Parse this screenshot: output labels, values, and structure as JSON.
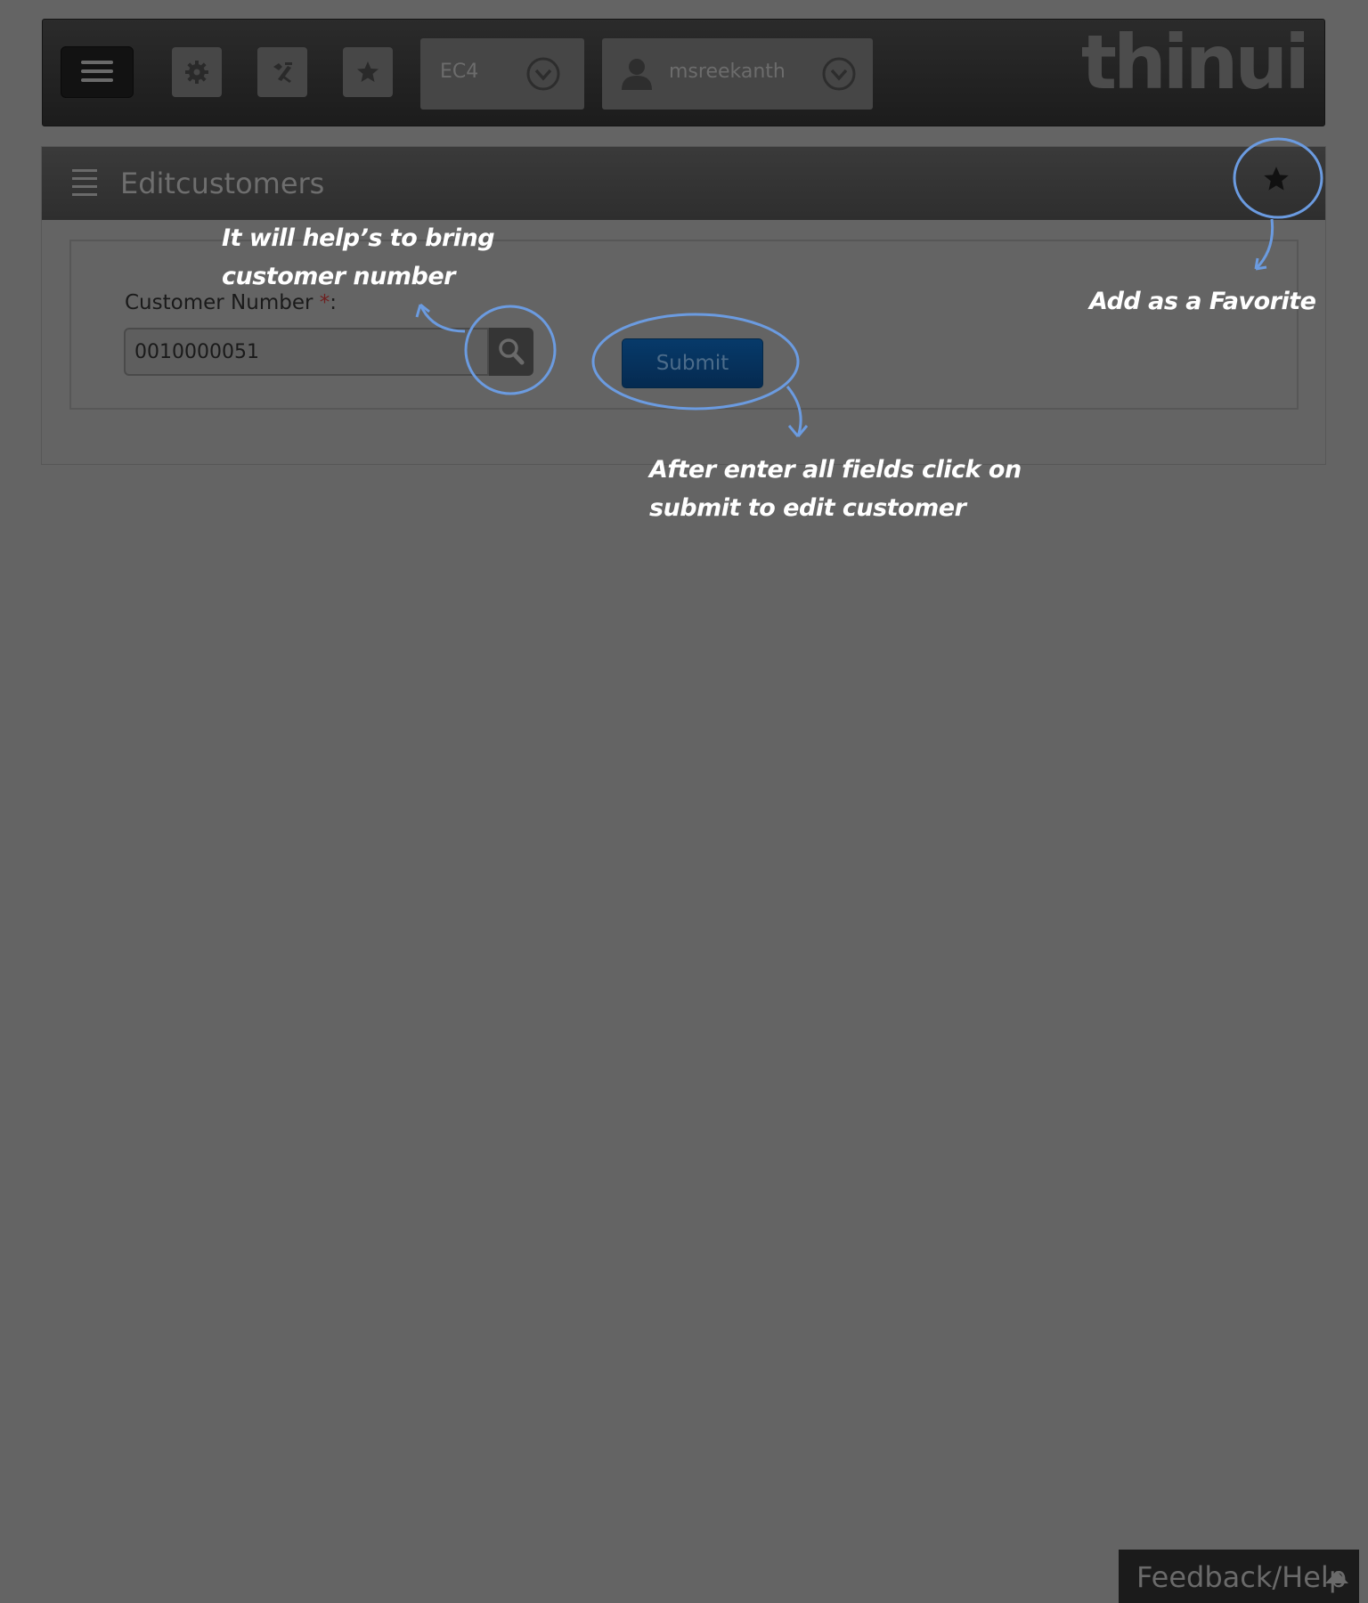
{
  "header": {
    "environment": "EC4",
    "username": "msreekanth",
    "logo": "thinui",
    "icons": [
      "menu-icon",
      "gear-icon",
      "tools-icon",
      "star-icon",
      "chevron-down-icon",
      "user-icon"
    ]
  },
  "page": {
    "title": "Editcustomers"
  },
  "form": {
    "customer_number_label": "Customer Number",
    "required_mark": "*",
    "label_colon": ":",
    "customer_number_value": "0010000051",
    "submit_label": "Submit"
  },
  "annotations": {
    "search_hint_line1": "It will help’s to bring",
    "search_hint_line2": "customer number",
    "favorite_hint": "Add as a Favorite",
    "submit_hint_line1": "After enter all fields click on",
    "submit_hint_line2": "submit to edit customer"
  },
  "footer": {
    "feedback_label": "Feedback/Help"
  },
  "colors": {
    "background": "#646464",
    "annotation_circle": "#6b9be0",
    "submit": "#063766"
  }
}
